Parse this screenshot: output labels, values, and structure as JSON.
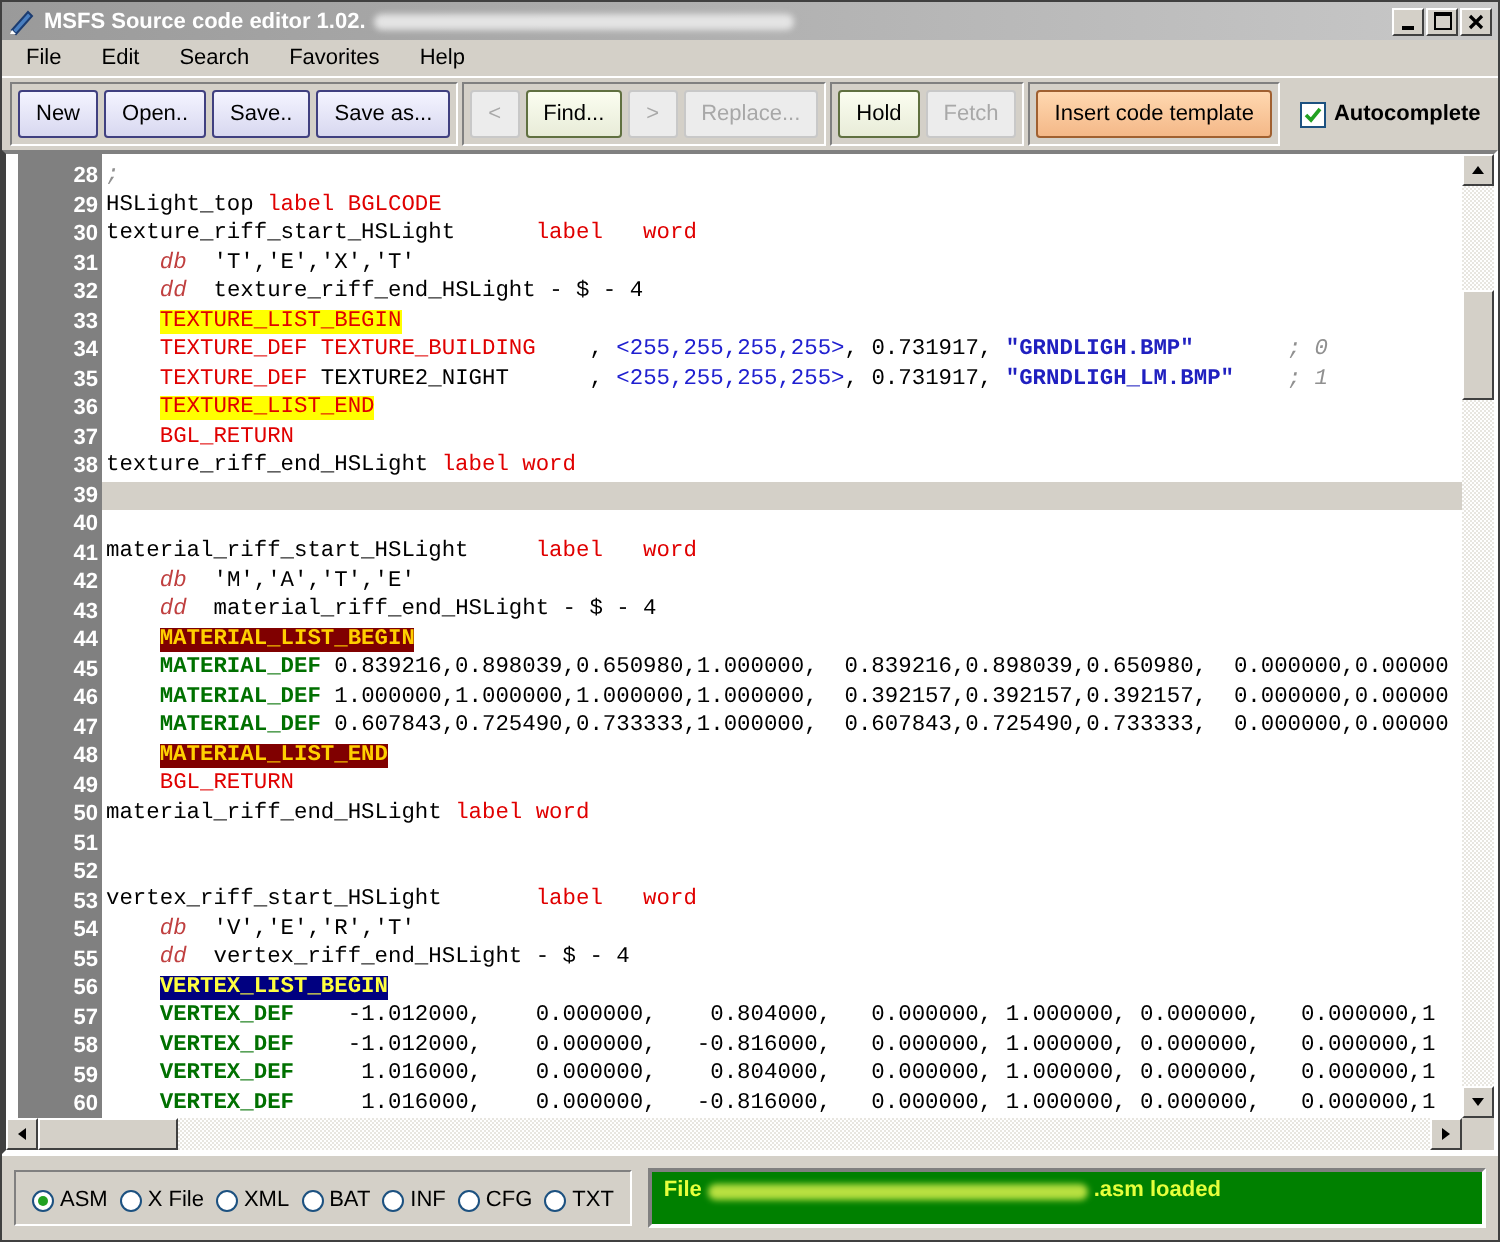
{
  "window": {
    "title": "MSFS Source code editor 1.02."
  },
  "menu": [
    "File",
    "Edit",
    "Search",
    "Favorites",
    "Help"
  ],
  "toolbar_groups": [
    [
      {
        "label": "New",
        "kind": "blue",
        "disabled": false
      },
      {
        "label": "Open..",
        "kind": "blue",
        "disabled": false
      },
      {
        "label": "Save..",
        "kind": "blue",
        "disabled": false
      },
      {
        "label": "Save as...",
        "kind": "blue",
        "disabled": false
      }
    ],
    [
      {
        "label": "<",
        "kind": "green",
        "disabled": true
      },
      {
        "label": "Find...",
        "kind": "green",
        "disabled": false
      },
      {
        "label": ">",
        "kind": "green",
        "disabled": true
      },
      {
        "label": "Replace...",
        "kind": "green",
        "disabled": true
      }
    ],
    [
      {
        "label": "Hold",
        "kind": "green",
        "disabled": false
      },
      {
        "label": "Fetch",
        "kind": "green",
        "disabled": true
      }
    ],
    [
      {
        "label": "Insert code template",
        "kind": "orange",
        "disabled": false
      }
    ]
  ],
  "autocomplete": {
    "label": "Autocomplete",
    "checked": true
  },
  "editor": {
    "lines": [
      {
        "n": "28",
        "current": false,
        "tokens": [
          {
            "kind": "comment",
            "text": ";"
          }
        ]
      },
      {
        "n": "29",
        "current": false,
        "tokens": [
          {
            "kind": "plain",
            "text": "HSLight_top "
          },
          {
            "kind": "keyword",
            "text": "label BGLCODE"
          }
        ]
      },
      {
        "n": "30",
        "current": false,
        "tokens": [
          {
            "kind": "plain",
            "text": "texture_riff_start_HSLight      "
          },
          {
            "kind": "keyword",
            "text": "label   word"
          }
        ]
      },
      {
        "n": "31",
        "current": false,
        "tokens": [
          {
            "kind": "directive",
            "text": "    db"
          },
          {
            "kind": "plain",
            "text": "  'T','E','X','T'"
          }
        ]
      },
      {
        "n": "32",
        "current": false,
        "tokens": [
          {
            "kind": "directive",
            "text": "    dd"
          },
          {
            "kind": "plain",
            "text": "  texture_riff_end_HSLight - $ - 4"
          }
        ]
      },
      {
        "n": "33",
        "current": false,
        "tokens": [
          {
            "kind": "marker",
            "text": "TEXTURE_LIST_BEGIN"
          }
        ]
      },
      {
        "n": "34",
        "current": false,
        "tokens": [
          {
            "kind": "keyword",
            "text": "    TEXTURE_DEF TEXTURE_BUILDING"
          },
          {
            "kind": "plain",
            "text": "    , "
          },
          {
            "kind": "number",
            "text": "<255,255,255,255>"
          },
          {
            "kind": "plain",
            "text": ", 0.731917, "
          },
          {
            "kind": "string",
            "text": "\"GRNDLIGH.BMP\""
          },
          {
            "kind": "comment",
            "text": "       ; 0"
          }
        ]
      },
      {
        "n": "35",
        "current": false,
        "tokens": [
          {
            "kind": "keyword",
            "text": "    TEXTURE_DEF"
          },
          {
            "kind": "plain",
            "text": " TEXTURE2_NIGHT      , "
          },
          {
            "kind": "number",
            "text": "<255,255,255,255>"
          },
          {
            "kind": "plain",
            "text": ", 0.731917, "
          },
          {
            "kind": "string",
            "text": "\"GRNDLIGH_LM.BMP\""
          },
          {
            "kind": "comment",
            "text": "    ; 1"
          }
        ]
      },
      {
        "n": "36",
        "current": false,
        "tokens": [
          {
            "kind": "marker",
            "text": "TEXTURE_LIST_END"
          }
        ]
      },
      {
        "n": "37",
        "current": false,
        "tokens": [
          {
            "kind": "keyword",
            "text": "    BGL_RETURN"
          }
        ]
      },
      {
        "n": "38",
        "current": false,
        "tokens": [
          {
            "kind": "plain",
            "text": "texture_riff_end_HSLight "
          },
          {
            "kind": "keyword",
            "text": "label word"
          }
        ]
      },
      {
        "n": "39",
        "current": true
      },
      {
        "n": "40",
        "current": false
      },
      {
        "n": "41",
        "current": false,
        "tokens": [
          {
            "kind": "plain",
            "text": "material_riff_start_HSLight     "
          },
          {
            "kind": "keyword",
            "text": "label   word"
          }
        ]
      },
      {
        "n": "42",
        "current": false,
        "tokens": [
          {
            "kind": "directive",
            "text": "    db"
          },
          {
            "kind": "plain",
            "text": "  'M','A','T','E'"
          }
        ]
      },
      {
        "n": "43",
        "current": false,
        "tokens": [
          {
            "kind": "directive",
            "text": "    dd"
          },
          {
            "kind": "plain",
            "text": "  material_riff_end_HSLight - $ - 4"
          }
        ]
      },
      {
        "n": "44",
        "current": false,
        "tokens": [
          {
            "kind": "material",
            "text": "MATERIAL_LIST_BEGIN"
          }
        ]
      },
      {
        "n": "45",
        "current": false,
        "tokens": [
          {
            "kind": "definition",
            "text": "    MATERIAL_DEF"
          },
          {
            "kind": "plain",
            "text": " 0.839216,0.898039,0.650980,1.000000,  0.839216,0.898039,0.650980,  0.000000,0.00000"
          }
        ]
      },
      {
        "n": "46",
        "current": false,
        "tokens": [
          {
            "kind": "definition",
            "text": "    MATERIAL_DEF"
          },
          {
            "kind": "plain",
            "text": " 1.000000,1.000000,1.000000,1.000000,  0.392157,0.392157,0.392157,  0.000000,0.00000"
          }
        ]
      },
      {
        "n": "47",
        "current": false,
        "tokens": [
          {
            "kind": "definition",
            "text": "    MATERIAL_DEF"
          },
          {
            "kind": "plain",
            "text": " 0.607843,0.725490,0.733333,1.000000,  0.607843,0.725490,0.733333,  0.000000,0.00000"
          }
        ]
      },
      {
        "n": "48",
        "current": false,
        "tokens": [
          {
            "kind": "material",
            "text": "MATERIAL_LIST_END"
          }
        ]
      },
      {
        "n": "49",
        "current": false,
        "tokens": [
          {
            "kind": "keyword",
            "text": "    BGL_RETURN"
          }
        ]
      },
      {
        "n": "50",
        "current": false,
        "tokens": [
          {
            "kind": "plain",
            "text": "material_riff_end_HSLight "
          },
          {
            "kind": "keyword",
            "text": "label word"
          }
        ]
      },
      {
        "n": "51",
        "current": false
      },
      {
        "n": "52",
        "current": false
      },
      {
        "n": "53",
        "current": false,
        "tokens": [
          {
            "kind": "plain",
            "text": "vertex_riff_start_HSLight       "
          },
          {
            "kind": "keyword",
            "text": "label   word"
          }
        ]
      },
      {
        "n": "54",
        "current": false,
        "tokens": [
          {
            "kind": "directive",
            "text": "    db"
          },
          {
            "kind": "plain",
            "text": "  'V','E','R','T'"
          }
        ]
      },
      {
        "n": "55",
        "current": false,
        "tokens": [
          {
            "kind": "directive",
            "text": "    dd"
          },
          {
            "kind": "plain",
            "text": "  vertex_riff_end_HSLight - $ - 4"
          }
        ]
      },
      {
        "n": "56",
        "current": false,
        "tokens": [
          {
            "kind": "vertex",
            "text": "VERTEX_LIST_BEGIN"
          }
        ]
      },
      {
        "n": "57",
        "current": false,
        "tokens": [
          {
            "kind": "definition",
            "text": "    VERTEX_DEF"
          },
          {
            "kind": "plain",
            "text": "    -1.012000,    0.000000,    0.804000,   0.000000, 1.000000, 0.000000,   0.000000,1"
          }
        ]
      },
      {
        "n": "58",
        "current": false,
        "tokens": [
          {
            "kind": "definition",
            "text": "    VERTEX_DEF"
          },
          {
            "kind": "plain",
            "text": "    -1.012000,    0.000000,   -0.816000,   0.000000, 1.000000, 0.000000,   0.000000,1"
          }
        ]
      },
      {
        "n": "59",
        "current": false,
        "tokens": [
          {
            "kind": "definition",
            "text": "    VERTEX_DEF"
          },
          {
            "kind": "plain",
            "text": "     1.016000,    0.000000,    0.804000,   0.000000, 1.000000, 0.000000,   0.000000,1"
          }
        ]
      },
      {
        "n": "60",
        "current": false,
        "tokens": [
          {
            "kind": "definition",
            "text": "    VERTEX_DEF"
          },
          {
            "kind": "plain",
            "text": "     1.016000,    0.000000,   -0.816000,   0.000000, 1.000000, 0.000000,   0.000000,1"
          }
        ]
      }
    ]
  },
  "file_types": [
    {
      "label": "ASM",
      "selected": true
    },
    {
      "label": "X File",
      "selected": false
    },
    {
      "label": "XML",
      "selected": false
    },
    {
      "label": "BAT",
      "selected": false
    },
    {
      "label": "INF",
      "selected": false
    },
    {
      "label": "CFG",
      "selected": false
    },
    {
      "label": "TXT",
      "selected": false
    }
  ],
  "status": {
    "prefix": "File",
    "suffix": ".asm loaded"
  }
}
